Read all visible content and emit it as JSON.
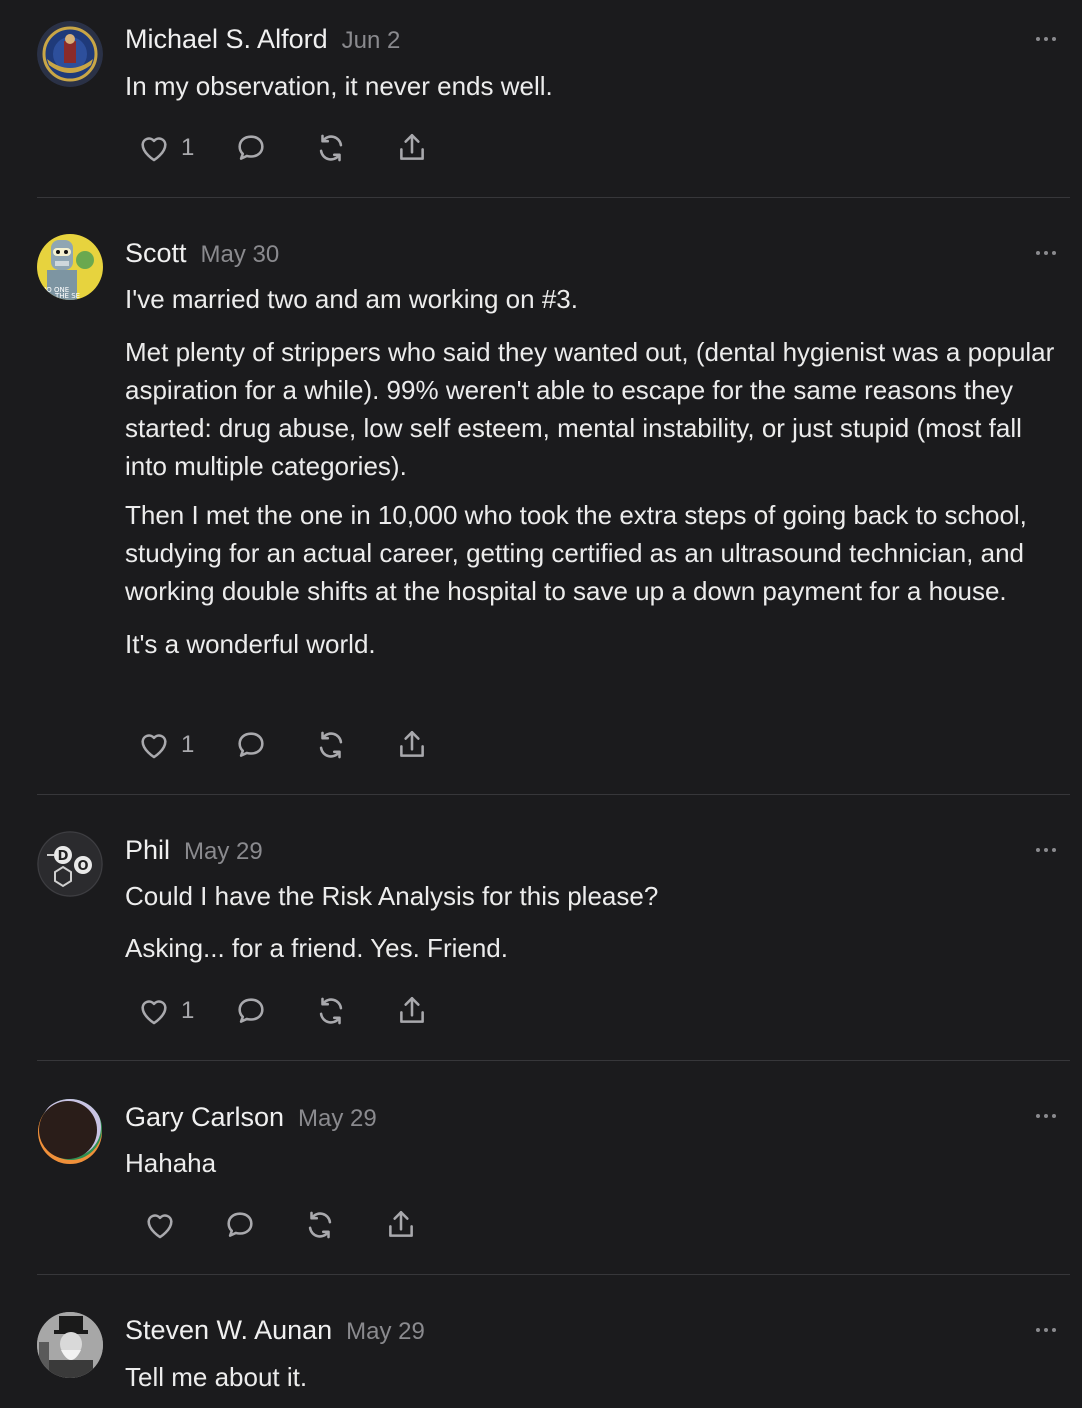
{
  "comments": [
    {
      "author": "Michael S. Alford",
      "date": "Jun 2",
      "paragraphs": [
        "In my observation, it never ends well."
      ],
      "likes": "1"
    },
    {
      "author": "Scott",
      "date": "May 30",
      "paragraphs": [
        "I've married two and am working on #3.",
        "Met plenty of strippers who said they wanted out, (dental hygienist was a popular aspiration for a while). 99% weren't able to escape for the same reasons they started: drug abuse, low self esteem, mental instability, or just stupid (most fall into multiple categories).",
        "Then I met the one in 10,000 who took the extra steps of going back to school, studying for an actual career, getting certified as an ultrasound technician, and working double shifts at the hospital to save up a down payment for a house.",
        "It's a wonderful world."
      ],
      "likes": "1",
      "avatar_text": [
        "NO ONE",
        "THE SE"
      ]
    },
    {
      "author": "Phil",
      "date": "May 29",
      "paragraphs": [
        "Could I have the Risk Analysis for this please?",
        "Asking... for a friend. Yes. Friend."
      ],
      "likes": "1",
      "avatar_text": [
        "D",
        "O"
      ]
    },
    {
      "author": "Gary Carlson",
      "date": "May 29",
      "paragraphs": [
        "Hahaha"
      ],
      "likes": ""
    },
    {
      "author": "Steven W. Aunan",
      "date": "May 29",
      "paragraphs": [
        "Tell me about it."
      ]
    }
  ],
  "icons": {
    "like": "heart-icon",
    "reply": "speech-bubble-icon",
    "restack": "restack-icon",
    "share": "share-icon",
    "more": "more-dots-icon"
  },
  "colors": {
    "background": "#1b1b1d",
    "text": "#ececec",
    "muted": "#8a8a8e",
    "icon": "#a9a9ad",
    "divider": "#37373a"
  }
}
